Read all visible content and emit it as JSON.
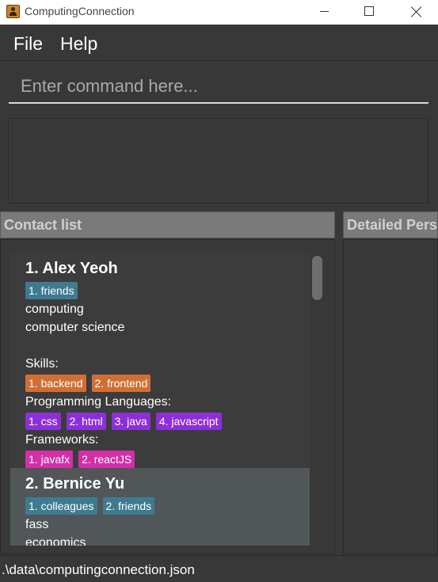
{
  "window": {
    "title": "ComputingConnection",
    "app_icon": "address-book-icon"
  },
  "menu": {
    "file": "File",
    "help": "Help"
  },
  "command": {
    "placeholder": "Enter command here..."
  },
  "panels": {
    "contact_list_header": "Contact list",
    "detail_header": "Detailed Pers"
  },
  "persons": [
    {
      "index_name": "1.  Alex Yeoh",
      "tags": [
        "1. friends"
      ],
      "faculty": "computing",
      "major": "computer science",
      "skills_label": "Skills:",
      "skills": [
        "1. backend",
        "2. frontend"
      ],
      "languages_label": "Programming Languages:",
      "languages": [
        "1. css",
        "2. html",
        "3. java",
        "4. javascript"
      ],
      "frameworks_label": "Frameworks:",
      "frameworks": [
        "1. javafx",
        "2. reactJS"
      ]
    },
    {
      "index_name": "2.  Bernice Yu",
      "tags": [
        "1. colleagues",
        "2. friends"
      ],
      "faculty": "fass",
      "major": "economics"
    }
  ],
  "colors": {
    "background": "#383838",
    "tag_teal": "#3e7b91",
    "tag_orange": "#d06f34",
    "tag_purple": "#8d2fd6",
    "tag_pink": "#d22fa8",
    "selected_card": "#515658"
  },
  "status": {
    "path": ".\\data\\computingconnection.json"
  }
}
